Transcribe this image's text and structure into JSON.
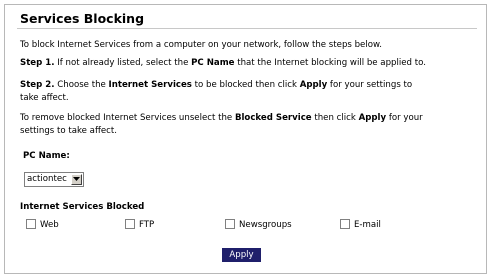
{
  "title": "Services Blocking",
  "intro": "To block Internet Services from a computer on your network, follow the steps below.",
  "step1": {
    "label": "Step 1.",
    "pre": " If not already listed, select the ",
    "bold": "PC Name",
    "post": " that the Internet blocking will be applied to."
  },
  "step2": {
    "label": "Step 2.",
    "pre": " Choose the ",
    "bold1": "Internet Services",
    "mid": " to be blocked then click ",
    "bold2": "Apply",
    "post1": " for your settings to",
    "post2": "take affect."
  },
  "remove": {
    "pre": "To remove blocked Internet Services unselect the ",
    "bold1": "Blocked Service",
    "mid": " then click ",
    "bold2": "Apply",
    "post1": " for your",
    "post2": "settings to take affect."
  },
  "pc_name": {
    "label": "PC Name:",
    "selected": "actiontec"
  },
  "services": {
    "heading": "Internet Services Blocked",
    "items": [
      {
        "label": "Web",
        "checked": false
      },
      {
        "label": "FTP",
        "checked": false
      },
      {
        "label": "Newsgroups",
        "checked": false
      },
      {
        "label": "E-mail",
        "checked": false
      }
    ]
  },
  "apply_label": "Apply",
  "colors": {
    "apply_bg": "#1f1f6b",
    "border": "#b8b8b8"
  }
}
